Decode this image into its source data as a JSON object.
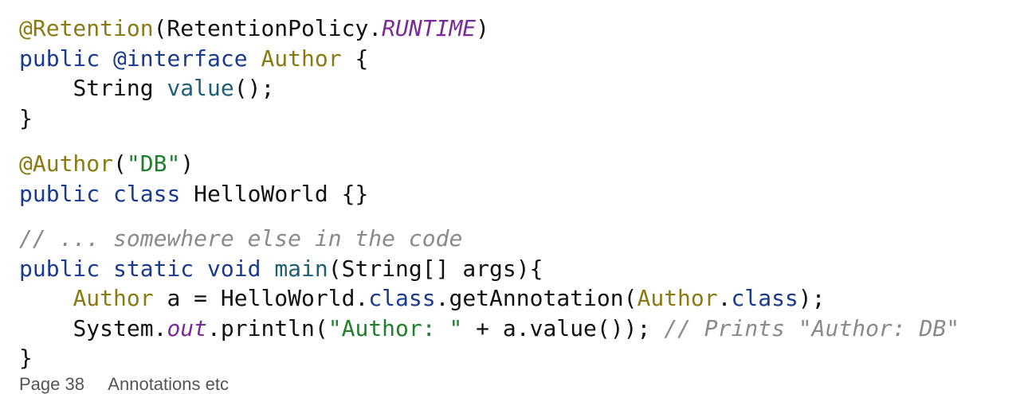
{
  "colors": {
    "keyword": "#1a3a8f",
    "annotation": "#8a7a10",
    "string": "#1f7f2a",
    "comment": "#8a8a8a",
    "constant": "#7a2a9a",
    "method": "#1d5f75",
    "text": "#111111"
  },
  "code": {
    "l1": {
      "ann": "@Retention",
      "open": "(RetentionPolicy.",
      "runtime": "RUNTIME",
      "close": ")"
    },
    "l2": {
      "kw_public": "public",
      "kw_interface": "@interface",
      "name": "Author",
      "brace": "{"
    },
    "l3": {
      "indent": "    ",
      "type": "String",
      "method": "value",
      "tail": "();"
    },
    "l4": {
      "text": "}"
    },
    "l5": {
      "ann": "@Author",
      "open": "(",
      "str": "\"DB\"",
      "close": ")"
    },
    "l6": {
      "kw_public": "public",
      "kw_class": "class",
      "rest": "HelloWorld {}"
    },
    "l7": {
      "comment": "// ... somewhere else in the code"
    },
    "l8": {
      "kw_public": "public",
      "kw_static": "static",
      "kw_void": "void",
      "method": "main",
      "rest": "(String[] args){"
    },
    "l9": {
      "indent": "    ",
      "type": "Author",
      "mid": " a = HelloWorld.",
      "kw_class": "class",
      "call": ".getAnnotation(",
      "type2": "Author",
      "dot": ".",
      "kw_class2": "class",
      "tail": ");"
    },
    "l10": {
      "indent": "    ",
      "sys": "System.",
      "out": "out",
      "print": ".println(",
      "str": "\"Author: \"",
      "rest": " + a.value()); ",
      "comment": "// Prints \"Author: DB\""
    },
    "l11": {
      "text": "}"
    }
  },
  "footer": {
    "fragment": "Page 38     Annotations etc"
  }
}
